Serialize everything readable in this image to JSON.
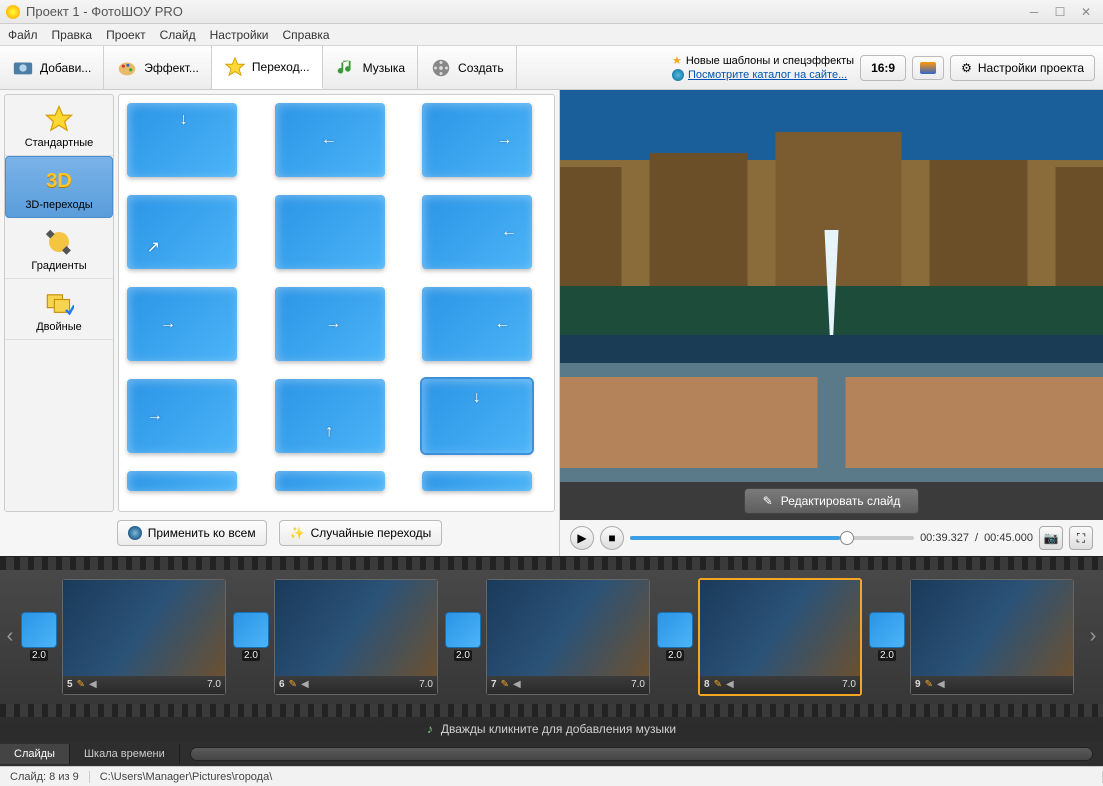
{
  "window": {
    "title": "Проект 1 - ФотоШОУ PRO"
  },
  "menu": [
    "Файл",
    "Правка",
    "Проект",
    "Слайд",
    "Настройки",
    "Справка"
  ],
  "toolbar": {
    "add": "Добави...",
    "effects": "Эффект...",
    "transitions": "Переход...",
    "music": "Музыка",
    "create": "Создать"
  },
  "info": {
    "new_templates": "Новые шаблоны и спецэффекты",
    "catalog_link": "Посмотрите каталог на сайте..."
  },
  "right_tools": {
    "aspect": "16:9",
    "settings": "Настройки проекта"
  },
  "categories": {
    "standard": "Стандартные",
    "3d": "3D-переходы",
    "gradients": "Градиенты",
    "doubles": "Двойные"
  },
  "buttons": {
    "apply_all": "Применить ко всем",
    "random": "Случайные переходы",
    "edit_slide": "Редактировать слайд"
  },
  "playback": {
    "current": "00:39.327",
    "total": "00:45.000"
  },
  "slides": [
    {
      "num": "5",
      "trans_time": "2.0",
      "dur": "7.0"
    },
    {
      "num": "6",
      "trans_time": "2.0",
      "dur": "7.0"
    },
    {
      "num": "7",
      "trans_time": "2.0",
      "dur": "7.0"
    },
    {
      "num": "8",
      "trans_time": "2.0",
      "dur": "7.0",
      "selected": true
    },
    {
      "num": "9",
      "trans_time": "2.0",
      "dur": ""
    }
  ],
  "audio_hint": "Дважды кликните для добавления музыки",
  "timeline_tabs": {
    "slides": "Слайды",
    "timeline": "Шкала времени"
  },
  "status": {
    "slide_pos": "Слайд: 8 из 9",
    "path": "C:\\Users\\Manager\\Pictures\\города\\"
  }
}
